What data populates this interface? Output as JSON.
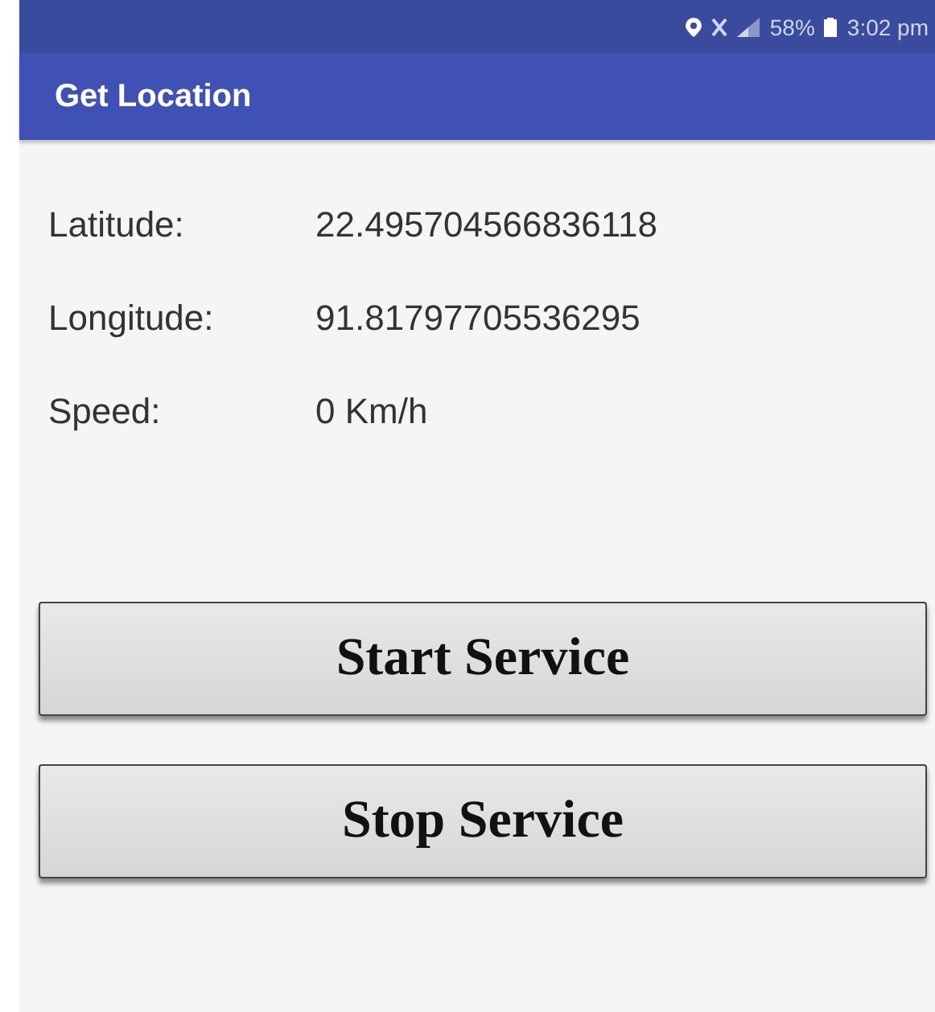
{
  "status_bar": {
    "battery": "58%",
    "time": "3:02 pm"
  },
  "app_bar": {
    "title": "Get Location"
  },
  "fields": [
    {
      "label": "Latitude:",
      "value": "22.495704566836118"
    },
    {
      "label": "Longitude:",
      "value": "91.81797705536295"
    },
    {
      "label": "Speed:",
      "value": "0 Km/h"
    }
  ],
  "buttons": [
    "Start Service",
    "Stop Service"
  ]
}
